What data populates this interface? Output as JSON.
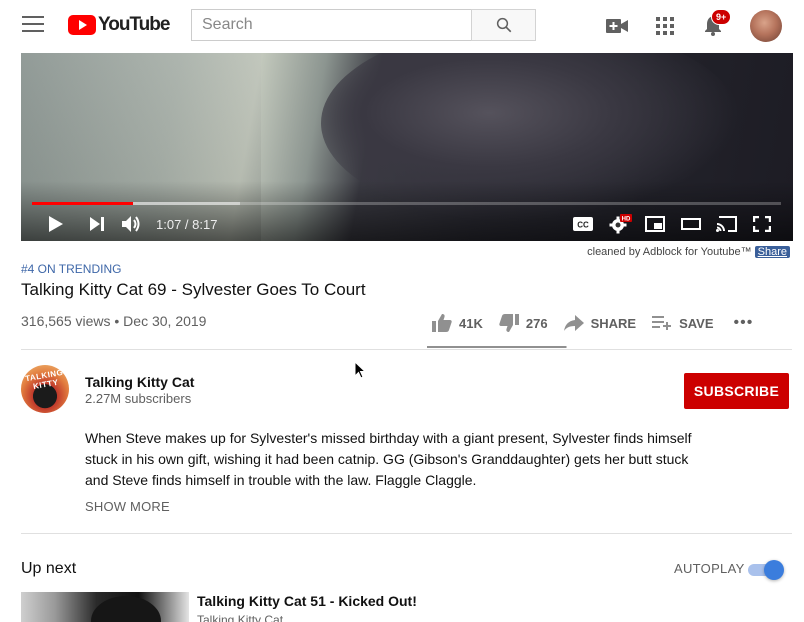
{
  "masthead": {
    "logo_text": "YouTube",
    "search_placeholder": "Search",
    "notification_badge": "9+",
    "icons": [
      "menu-icon",
      "youtube-logo-icon",
      "search-icon",
      "create-video-icon",
      "apps-grid-icon",
      "bell-icon",
      "account-avatar"
    ]
  },
  "player": {
    "time_display": "1:07 / 8:17",
    "progress_played_fraction": 0.135,
    "progress_loaded_fraction": 0.278,
    "hd_badge": "HD",
    "controls": [
      "play-icon",
      "next-icon",
      "volume-icon",
      "captions-icon",
      "settings-icon",
      "miniplayer-icon",
      "theater-icon",
      "cast-icon",
      "fullscreen-icon"
    ],
    "captions_label": "CC"
  },
  "adblock": {
    "note": "cleaned by Adblock for Youtube™",
    "share_label": "Share"
  },
  "video": {
    "trending": "#4 ON TRENDING",
    "title": "Talking Kitty Cat 69 - Sylvester Goes To Court",
    "views_date": "316,565 views • Dec 30, 2019",
    "likes": "41K",
    "dislikes": "276",
    "share_label": "SHARE",
    "save_label": "SAVE",
    "more_label": "•••",
    "like_ratio": 0.993
  },
  "channel": {
    "name": "Talking Kitty Cat",
    "subscribers": "2.27M subscribers",
    "avatar_text": "TALKING KITTY",
    "subscribe_label": "SUBSCRIBE"
  },
  "description": {
    "text": "When Steve makes up for Sylvester's missed birthday with a giant present, Sylvester finds himself stuck in his own gift, wishing it had been catnip. GG (Gibson's Granddaughter) gets her butt stuck and Steve finds himself in trouble with the law. Flaggle Claggle.",
    "show_more_label": "SHOW MORE"
  },
  "up_next": {
    "heading": "Up next",
    "autoplay_label": "AUTOPLAY",
    "autoplay_on": true,
    "items": [
      {
        "title": "Talking Kitty Cat 51 - Kicked Out!",
        "channel": "Talking Kitty Cat"
      }
    ]
  },
  "colors": {
    "brand_red": "#ff0000",
    "subscribe_red": "#cc0000",
    "link_blue": "#3e67a8",
    "toggle_blue": "#3b7ddd"
  }
}
